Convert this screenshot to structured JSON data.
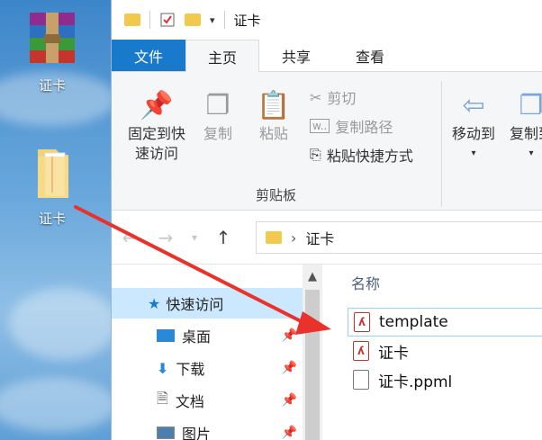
{
  "desktop": {
    "icons": [
      {
        "label": "证卡",
        "icon": "winrar-archive-icon"
      },
      {
        "label": "证卡",
        "icon": "folder-icon"
      }
    ]
  },
  "window": {
    "title": "证卡"
  },
  "ribbon": {
    "tabs": [
      {
        "label": "文件"
      },
      {
        "label": "主页"
      },
      {
        "label": "共享"
      },
      {
        "label": "查看"
      }
    ],
    "pin_quick_access": "固定到快\n速访问",
    "copy": "复制",
    "paste": "粘贴",
    "cut": "剪切",
    "copy_path": "复制路径",
    "paste_shortcut": "粘贴快捷方式",
    "clipboard_group": "剪贴板",
    "move_to": "移动到",
    "copy_to": "复制到"
  },
  "address": {
    "path": "证卡"
  },
  "navpane": {
    "items": [
      {
        "label": "快速访问",
        "icon": "star-icon"
      },
      {
        "label": "桌面",
        "icon": "desktop-icon"
      },
      {
        "label": "下载",
        "icon": "download-icon"
      },
      {
        "label": "文档",
        "icon": "document-icon"
      },
      {
        "label": "图片",
        "icon": "picture-icon"
      }
    ]
  },
  "filepane": {
    "column_name": "名称",
    "files": [
      {
        "name": "template",
        "icon": "pdf-icon"
      },
      {
        "name": "证卡",
        "icon": "pdf-icon"
      },
      {
        "name": "证卡.ppml",
        "icon": "file-icon"
      }
    ]
  },
  "colors": {
    "accent": "#1979ca",
    "arrow": "#e8322b",
    "selection": "#cce8ff"
  }
}
